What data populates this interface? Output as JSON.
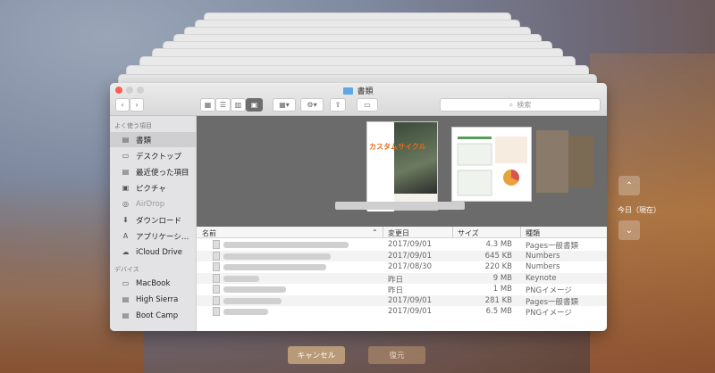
{
  "window": {
    "title": "書類",
    "search_placeholder": "検索"
  },
  "sidebar": {
    "favorites_header": "よく使う項目",
    "favorites": [
      {
        "label": "書類",
        "icon": "documents-icon",
        "selected": true
      },
      {
        "label": "デスクトップ",
        "icon": "desktop-icon"
      },
      {
        "label": "最近使った項目",
        "icon": "recents-icon"
      },
      {
        "label": "ピクチャ",
        "icon": "pictures-icon"
      },
      {
        "label": "AirDrop",
        "icon": "airdrop-icon",
        "dim": true
      },
      {
        "label": "ダウンロード",
        "icon": "downloads-icon"
      },
      {
        "label": "アプリケーシ…",
        "icon": "applications-icon"
      },
      {
        "label": "iCloud Drive",
        "icon": "cloud-icon"
      }
    ],
    "devices_header": "デバイス",
    "devices": [
      {
        "label": "MacBook",
        "icon": "laptop-icon"
      },
      {
        "label": "High Sierra",
        "icon": "disk-icon"
      },
      {
        "label": "Boot Camp",
        "icon": "disk-icon"
      }
    ]
  },
  "preview": {
    "cover_title": "カスタムサイクル"
  },
  "list": {
    "headers": {
      "name": "名前",
      "date": "変更日",
      "size": "サイズ",
      "kind": "種類"
    },
    "rows": [
      {
        "date": "2017/09/01",
        "size": "4.3 MB",
        "kind": "Pages一般書類"
      },
      {
        "date": "2017/09/01",
        "size": "645 KB",
        "kind": "Numbers"
      },
      {
        "date": "2017/08/30",
        "size": "220 KB",
        "kind": "Numbers"
      },
      {
        "date": "昨日",
        "size": "9 MB",
        "kind": "Keynote"
      },
      {
        "date": "昨日",
        "size": "1 MB",
        "kind": "PNGイメージ"
      },
      {
        "date": "2017/09/01",
        "size": "281 KB",
        "kind": "Pages一般書類"
      },
      {
        "date": "2017/09/01",
        "size": "6.5 MB",
        "kind": "PNGイメージ"
      }
    ]
  },
  "timemachine": {
    "label": "今日（現在）",
    "up_icon": "chevron-up-icon",
    "down_icon": "chevron-down-icon"
  },
  "buttons": {
    "cancel": "キャンセル",
    "restore": "復元"
  }
}
